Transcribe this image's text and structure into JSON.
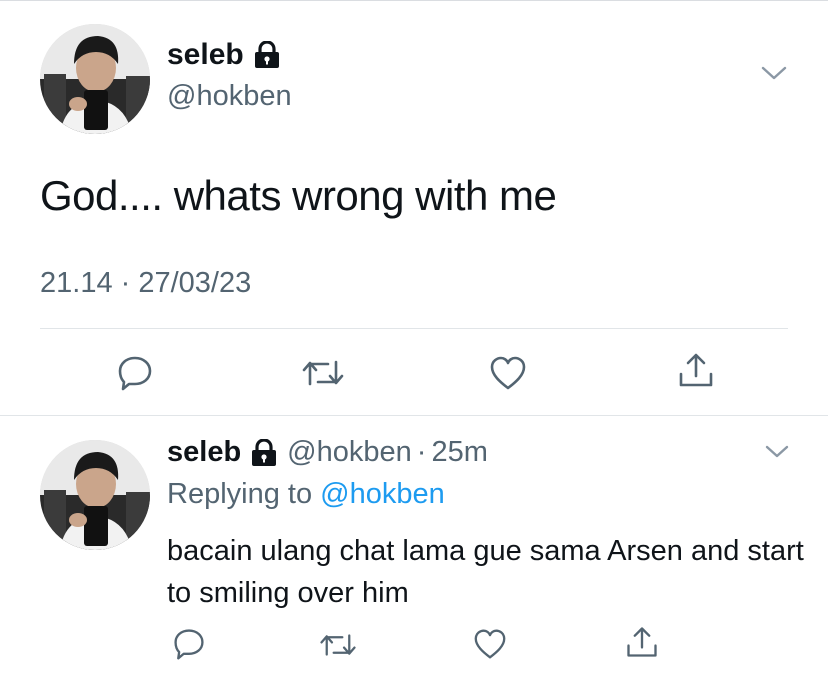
{
  "tweet": {
    "display_name": "seleb",
    "handle": "@hokben",
    "text": "God.... whats wrong with me",
    "timestamp": "21.14 · 27/03/23",
    "icons": [
      "lock-icon",
      "chevron-down-icon",
      "reply-icon",
      "retweet-icon",
      "like-icon",
      "share-icon"
    ]
  },
  "reply": {
    "display_name": "seleb",
    "handle": "@hokben",
    "separator": "·",
    "time_ago": "25m",
    "replying_prefix": "Replying to",
    "replying_to": "@hokben",
    "text": "bacain ulang chat lama gue sama Arsen and start to smiling over him"
  },
  "colors": {
    "text": "#0f1419",
    "secondary": "#536471",
    "link": "#1d9bf0",
    "divider": "#e1e5e8"
  }
}
